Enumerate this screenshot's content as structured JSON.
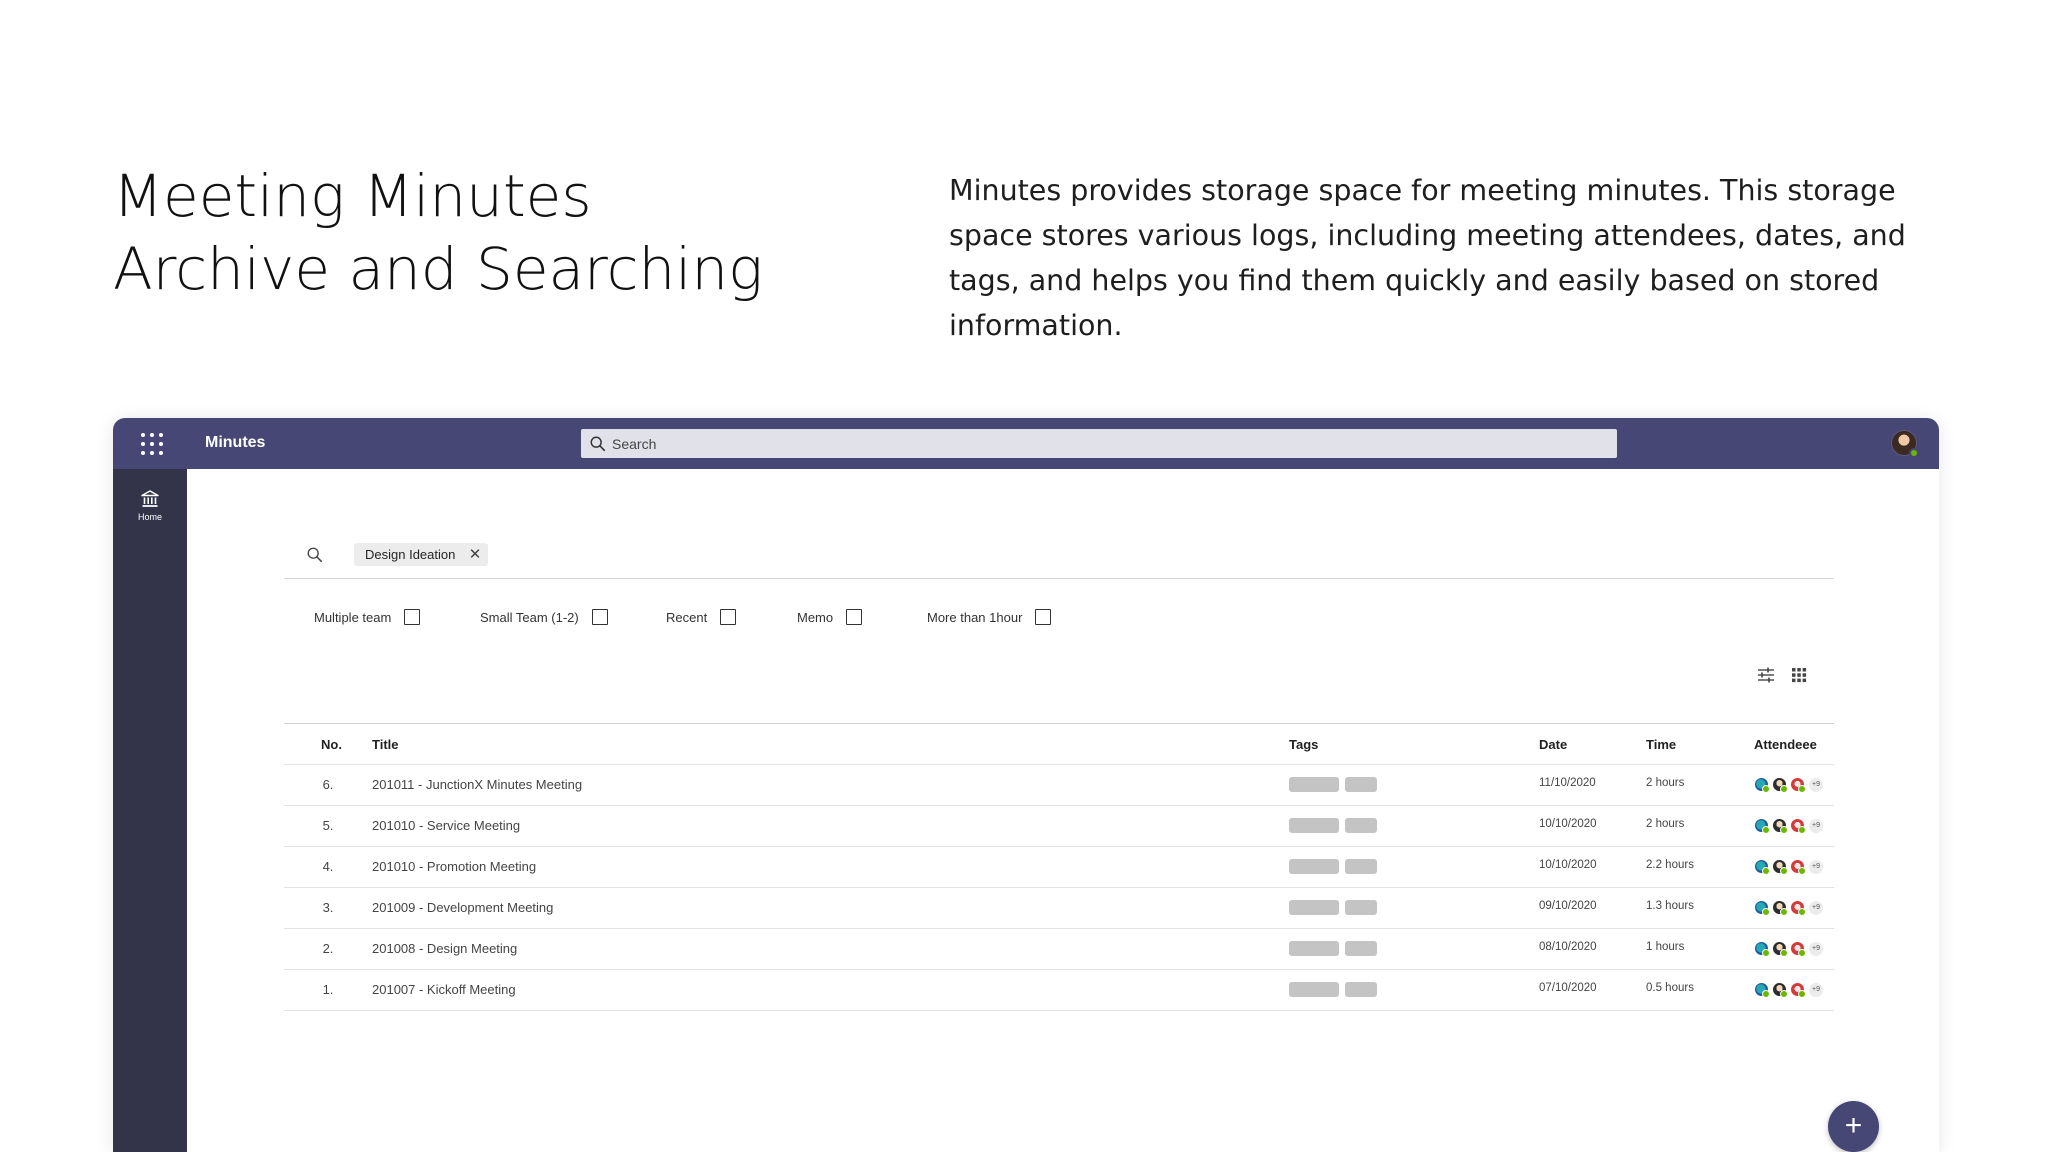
{
  "hero": {
    "title_line1": "Meeting Minutes",
    "title_line2": "Archive and Searching",
    "description": "Minutes provides storage space for meeting minutes. This storage space stores various logs, including meeting attendees, dates, and tags, and helps you find them quickly and easily based on stored information."
  },
  "app": {
    "name": "Minutes",
    "search_placeholder": "Search",
    "accent_color": "#464775",
    "sidebar_color": "#33344a"
  },
  "sidebar": {
    "items": [
      {
        "label": "Home",
        "icon": "bank-icon"
      }
    ]
  },
  "filters": {
    "chip": "Design Ideation",
    "checkboxes": [
      {
        "label": "Multiple team",
        "checked": false
      },
      {
        "label": "Small Team (1-2)",
        "checked": false
      },
      {
        "label": "Recent",
        "checked": false
      },
      {
        "label": "Memo",
        "checked": false
      },
      {
        "label": "More than 1hour",
        "checked": false
      }
    ]
  },
  "table": {
    "headers": {
      "no": "No.",
      "title": "Title",
      "tags": "Tags",
      "date": "Date",
      "time": "Time",
      "attendee": "Attendeee"
    },
    "rows": [
      {
        "no": "6.",
        "title": "201011 - JunctionX Minutes Meeting",
        "date": "11/10/2020",
        "time": "2 hours",
        "more": "+9"
      },
      {
        "no": "5.",
        "title": "201010 - Service Meeting",
        "date": "10/10/2020",
        "time": "2 hours",
        "more": "+9"
      },
      {
        "no": "4.",
        "title": "201010 - Promotion Meeting",
        "date": "10/10/2020",
        "time": "2.2 hours",
        "more": "+9"
      },
      {
        "no": "3.",
        "title": "201009 - Development Meeting",
        "date": "09/10/2020",
        "time": "1.3 hours",
        "more": "+9"
      },
      {
        "no": "2.",
        "title": "201008 - Design Meeting",
        "date": "08/10/2020",
        "time": "1 hours",
        "more": "+9"
      },
      {
        "no": "1.",
        "title": "201007 - Kickoff Meeting",
        "date": "07/10/2020",
        "time": "0.5 hours",
        "more": "+9"
      }
    ]
  },
  "fab": {
    "label": "+"
  }
}
